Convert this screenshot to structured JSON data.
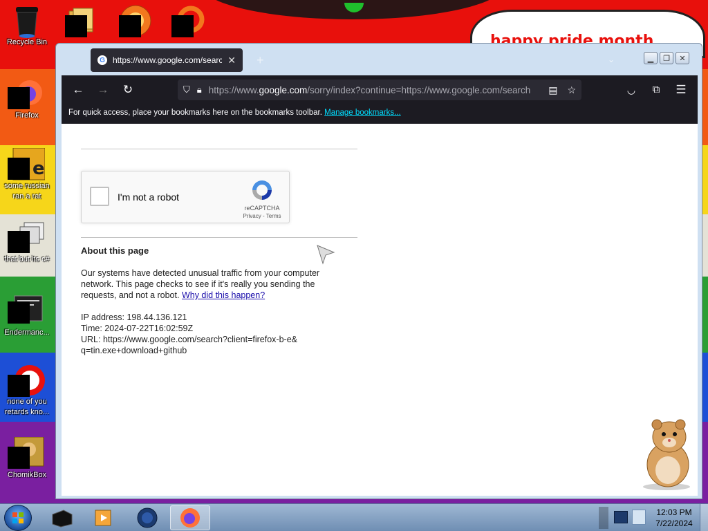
{
  "desktop": {
    "banner_text": "happy pride month",
    "icons": [
      {
        "label": "Recycle Bin"
      },
      {
        "label": "Firefox"
      },
      {
        "label": "some russian ran a rat"
      },
      {
        "label": "that but its c#"
      },
      {
        "label": "Endermanc..."
      },
      {
        "label": "none of you retards kno..."
      },
      {
        "label": "ChomikBox"
      }
    ]
  },
  "browser": {
    "tab_title": "https://www.google.com/search",
    "new_tab_symbol": "+",
    "url_prefix": "https://www.",
    "url_domain": "google.com",
    "url_rest": "/sorry/index?continue=https://www.google.com/search",
    "bookmarks_text": "For quick access, place your bookmarks here on the bookmarks toolbar.",
    "bookmarks_link": "Manage bookmarks..."
  },
  "page": {
    "captcha_label": "I'm not a robot",
    "captcha_brand": "reCAPTCHA",
    "captcha_links": "Privacy - Terms",
    "about_title": "About this page",
    "about_body": "Our systems have detected unusual traffic from your computer network. This page checks to see if it's really you sending the requests, and not a robot.",
    "about_link": "Why did this happen?",
    "ip_line": "IP address: 198.44.136.121",
    "time_line": "Time: 2024-07-22T16:02:59Z",
    "url_line1": "URL: https://www.google.com/search?client=firefox-b-e&",
    "url_line2": "q=tin.exe+download+github"
  },
  "taskbar": {
    "time": "12:03 PM",
    "date": "7/22/2024"
  }
}
